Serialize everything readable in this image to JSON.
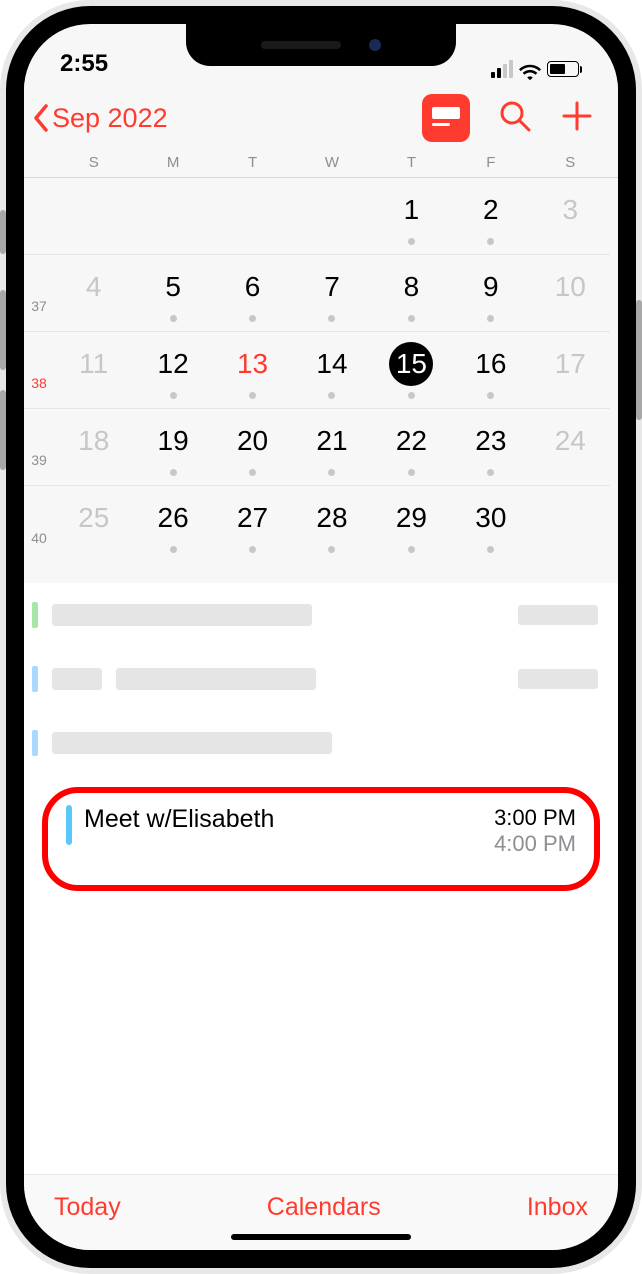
{
  "status": {
    "time": "2:55"
  },
  "nav": {
    "back_label": "Sep 2022"
  },
  "weekday_labels": [
    "S",
    "M",
    "T",
    "W",
    "T",
    "F",
    "S"
  ],
  "weeks": [
    {
      "wk": "",
      "days": [
        {
          "n": "",
          "dot": false,
          "class": ""
        },
        {
          "n": "",
          "dot": false,
          "class": ""
        },
        {
          "n": "",
          "dot": false,
          "class": ""
        },
        {
          "n": "",
          "dot": false,
          "class": ""
        },
        {
          "n": "1",
          "dot": true,
          "class": ""
        },
        {
          "n": "2",
          "dot": true,
          "class": ""
        },
        {
          "n": "3",
          "dot": false,
          "class": "weekend"
        }
      ]
    },
    {
      "wk": "37",
      "days": [
        {
          "n": "4",
          "dot": false,
          "class": "weekend"
        },
        {
          "n": "5",
          "dot": true,
          "class": ""
        },
        {
          "n": "6",
          "dot": true,
          "class": ""
        },
        {
          "n": "7",
          "dot": true,
          "class": ""
        },
        {
          "n": "8",
          "dot": true,
          "class": ""
        },
        {
          "n": "9",
          "dot": true,
          "class": ""
        },
        {
          "n": "10",
          "dot": false,
          "class": "weekend"
        }
      ]
    },
    {
      "wk": "38",
      "wk_class": "current",
      "days": [
        {
          "n": "11",
          "dot": false,
          "class": "weekend"
        },
        {
          "n": "12",
          "dot": true,
          "class": ""
        },
        {
          "n": "13",
          "dot": true,
          "class": "today"
        },
        {
          "n": "14",
          "dot": true,
          "class": ""
        },
        {
          "n": "15",
          "dot": true,
          "class": "selected"
        },
        {
          "n": "16",
          "dot": true,
          "class": ""
        },
        {
          "n": "17",
          "dot": false,
          "class": "weekend"
        }
      ]
    },
    {
      "wk": "39",
      "days": [
        {
          "n": "18",
          "dot": false,
          "class": "weekend"
        },
        {
          "n": "19",
          "dot": true,
          "class": ""
        },
        {
          "n": "20",
          "dot": true,
          "class": ""
        },
        {
          "n": "21",
          "dot": true,
          "class": ""
        },
        {
          "n": "22",
          "dot": true,
          "class": ""
        },
        {
          "n": "23",
          "dot": true,
          "class": ""
        },
        {
          "n": "24",
          "dot": false,
          "class": "weekend"
        }
      ]
    },
    {
      "wk": "40",
      "days": [
        {
          "n": "25",
          "dot": false,
          "class": "weekend"
        },
        {
          "n": "26",
          "dot": true,
          "class": ""
        },
        {
          "n": "27",
          "dot": true,
          "class": ""
        },
        {
          "n": "28",
          "dot": true,
          "class": ""
        },
        {
          "n": "29",
          "dot": true,
          "class": ""
        },
        {
          "n": "30",
          "dot": true,
          "class": ""
        },
        {
          "n": "",
          "dot": false,
          "class": ""
        }
      ]
    }
  ],
  "highlighted_event": {
    "title": "Meet w/Elisabeth",
    "start": "3:00 PM",
    "end": "4:00 PM",
    "stripe_color": "#5ac8fa"
  },
  "toolbar": {
    "today": "Today",
    "calendars": "Calendars",
    "inbox": "Inbox"
  },
  "colors": {
    "accent": "#ff3b30"
  }
}
